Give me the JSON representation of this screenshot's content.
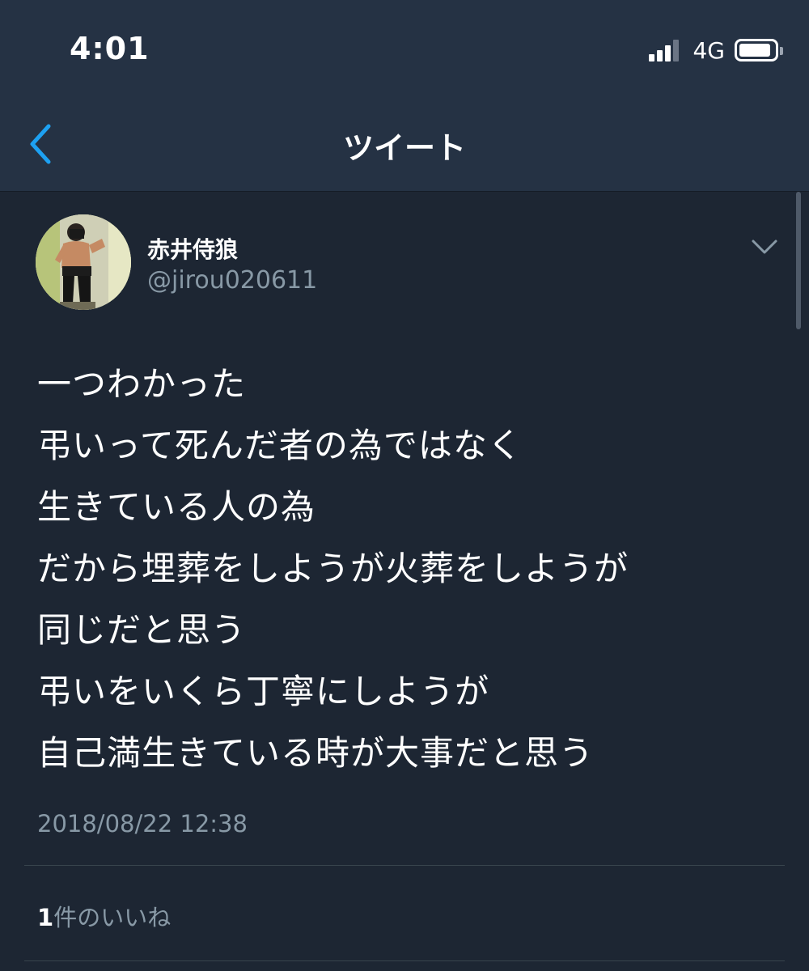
{
  "status_bar": {
    "time": "4:01",
    "network": "4G",
    "icons": [
      "signal-icon",
      "battery-icon"
    ]
  },
  "nav": {
    "title": "ツイート",
    "back_icon": "chevron-left-icon"
  },
  "tweet": {
    "display_name": "赤井侍狼",
    "handle": "@jirou020611",
    "menu_icon": "chevron-down-icon",
    "lines": [
      "一つわかった",
      "弔いって死んだ者の為ではなく",
      "生きている人の為",
      "だから埋葬をしようが火葬をしようが",
      "同じだと思う",
      "弔いをいくら丁寧にしようが",
      "自己満生きている時が大事だと思う"
    ],
    "timestamp": "2018/08/22 12:38",
    "likes_count": "1",
    "likes_label": "件のいいね"
  },
  "colors": {
    "background": "#1d2633",
    "header_background": "#253244",
    "accent": "#1da1f2",
    "secondary_text": "#8899a6",
    "divider": "#38444d"
  }
}
